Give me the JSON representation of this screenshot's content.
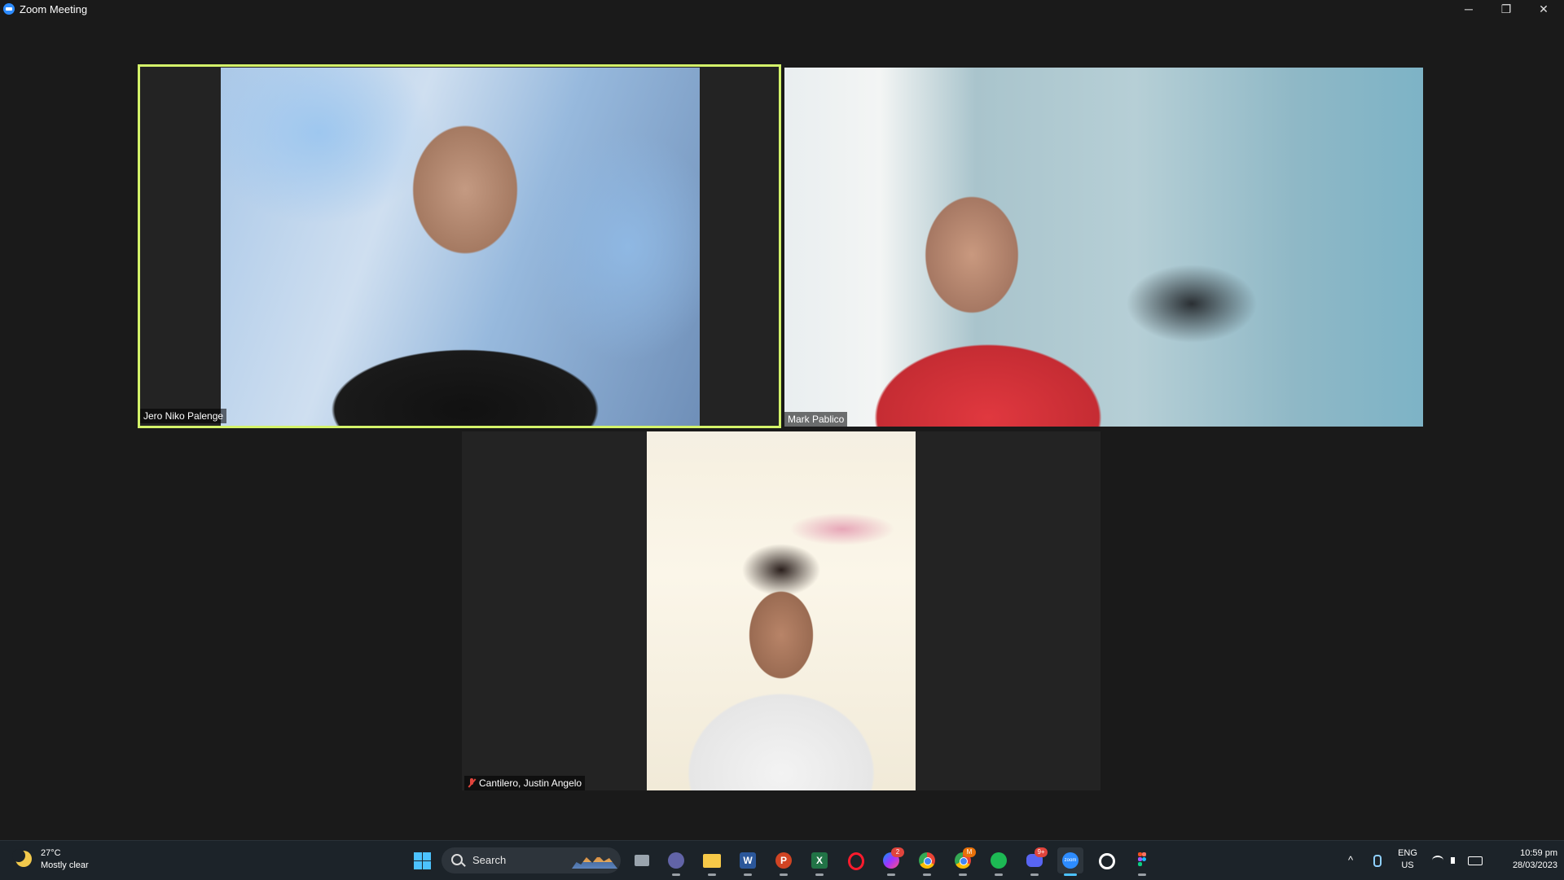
{
  "window": {
    "title": "Zoom Meeting",
    "minimize_glyph": "─",
    "maximize_glyph": "❐",
    "close_glyph": "✕"
  },
  "participants": [
    {
      "name": "Jero Niko Palenge",
      "active_speaker": true,
      "muted": false
    },
    {
      "name": "Mark Pablico",
      "active_speaker": false,
      "muted": false
    },
    {
      "name": "Cantilero, Justin Angelo",
      "active_speaker": false,
      "muted": true
    }
  ],
  "colors": {
    "active_speaker_border": "#d4f36a",
    "muted_icon": "#e0443c",
    "taskbar_bg": "#1c2329"
  },
  "taskbar": {
    "weather": {
      "temp": "27°C",
      "condition": "Mostly clear",
      "icon": "moon-cloud-icon"
    },
    "search": {
      "placeholder": "Search"
    },
    "apps": [
      {
        "name": "task-view",
        "icon": "task-view-icon"
      },
      {
        "name": "teams",
        "icon": "video-chat-icon"
      },
      {
        "name": "file-explorer",
        "icon": "folder-icon"
      },
      {
        "name": "word",
        "label": "W",
        "icon": "word-icon"
      },
      {
        "name": "powerpoint",
        "label": "P",
        "icon": "powerpoint-icon"
      },
      {
        "name": "excel",
        "label": "X",
        "icon": "excel-icon"
      },
      {
        "name": "opera",
        "label": "O",
        "icon": "opera-icon"
      },
      {
        "name": "messenger",
        "badge": "2",
        "icon": "messenger-icon"
      },
      {
        "name": "chrome-1",
        "icon": "chrome-icon"
      },
      {
        "name": "chrome-2",
        "badge": "M",
        "icon": "chrome-icon"
      },
      {
        "name": "spotify",
        "icon": "spotify-icon"
      },
      {
        "name": "discord",
        "badge": "9+",
        "icon": "discord-icon"
      },
      {
        "name": "zoom",
        "label": "zoom",
        "icon": "zoom-icon"
      },
      {
        "name": "clock-app",
        "icon": "timer-icon"
      },
      {
        "name": "figma",
        "icon": "figma-icon"
      }
    ],
    "tray": {
      "chevron": "^",
      "lang_line1": "ENG",
      "lang_line2": "US",
      "time": "10:59 pm",
      "date": "28/03/2023"
    }
  }
}
